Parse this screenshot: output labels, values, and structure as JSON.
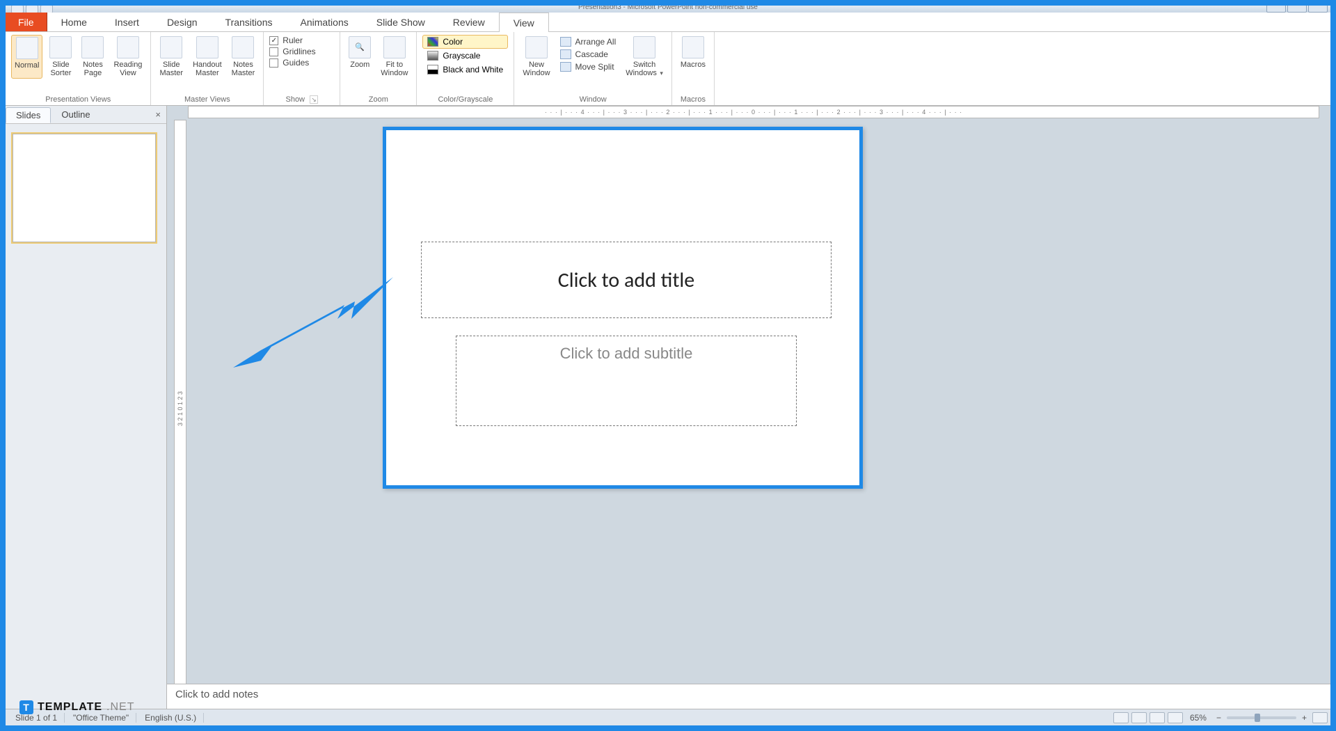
{
  "window": {
    "title": "Presentation3 - Microsoft PowerPoint non-commercial use"
  },
  "menu": {
    "file": "File",
    "tabs": [
      "Home",
      "Insert",
      "Design",
      "Transitions",
      "Animations",
      "Slide Show",
      "Review",
      "View"
    ],
    "active": "View"
  },
  "ribbon": {
    "presentation_views": {
      "title": "Presentation Views",
      "normal": "Normal",
      "slide_sorter": "Slide\nSorter",
      "notes_page": "Notes\nPage",
      "reading_view": "Reading\nView"
    },
    "master_views": {
      "title": "Master Views",
      "slide_master": "Slide\nMaster",
      "handout_master": "Handout\nMaster",
      "notes_master": "Notes\nMaster"
    },
    "show": {
      "title": "Show",
      "ruler": "Ruler",
      "gridlines": "Gridlines",
      "guides": "Guides"
    },
    "zoom": {
      "title": "Zoom",
      "zoom": "Zoom",
      "fit": "Fit to\nWindow"
    },
    "color_grayscale": {
      "title": "Color/Grayscale",
      "color": "Color",
      "grayscale": "Grayscale",
      "bw": "Black and White"
    },
    "window_group": {
      "title": "Window",
      "new_window": "New\nWindow",
      "arrange_all": "Arrange All",
      "cascade": "Cascade",
      "move_split": "Move Split",
      "switch": "Switch\nWindows"
    },
    "macros": {
      "title": "Macros",
      "macros": "Macros"
    }
  },
  "side_panel": {
    "tabs": {
      "slides": "Slides",
      "outline": "Outline"
    }
  },
  "slide": {
    "title_placeholder": "Click to add title",
    "subtitle_placeholder": "Click to add subtitle"
  },
  "notes": {
    "placeholder": "Click to add notes"
  },
  "status": {
    "slide_info": "Slide 1 of 1",
    "theme": "\"Office Theme\"",
    "language": "English (U.S.)",
    "zoom_label": "65%"
  },
  "ruler": {
    "h_marks": "· · · | · · · 4 · · · | · · · 3 · · · | · · · 2 · · · | · · · 1 · · · | · · · 0 · · · | · · · 1 · · · | · · · 2 · · · | · · · 3 · · · | · · · 4 · · · | · · ·"
  },
  "watermark": {
    "brand": "TEMPLATE",
    "suffix": ".NET"
  }
}
